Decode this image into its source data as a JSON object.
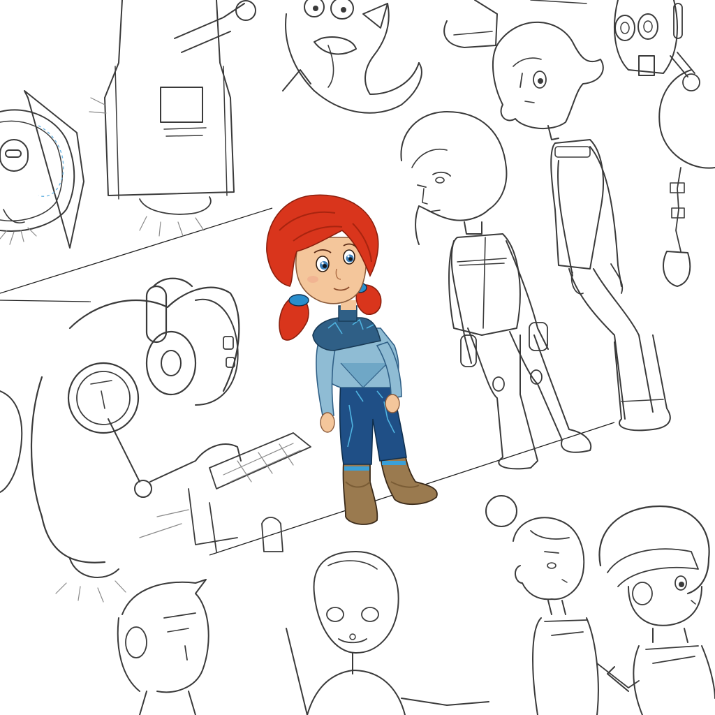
{
  "palette": {
    "paper": "#ffffff",
    "pencil": "#3a3a3a",
    "pencil_light": "#8a8a8a",
    "hair": "#d9351c",
    "hair_shadow": "#a8240f",
    "skin": "#f4c69b",
    "skin_shadow": "#e6a878",
    "eye": "#3d7fb8",
    "top_dark": "#2f5f86",
    "top_light": "#8fbcd4",
    "pants": "#1f4f86",
    "pattern": "#4fb3e0",
    "boot": "#9a7a4f",
    "boot_shadow": "#7a5c35",
    "boot_band": "#3aa0d8",
    "hair_tie": "#2a8ecc",
    "blue_guide": "#6fb7e3"
  },
  "figures": [
    "colored-girl-red-pigtails",
    "sketch-tall-boy",
    "sketch-short-hair-figure",
    "sketch-robot-with-headphones",
    "sketch-apron-figure",
    "sketch-round-robot-left",
    "sketch-creature-top",
    "sketch-robot-top-right",
    "sketch-girl-with-bun",
    "sketch-boy-with-headband",
    "sketch-cap-boy-bottom",
    "sketch-alien-bottom"
  ]
}
